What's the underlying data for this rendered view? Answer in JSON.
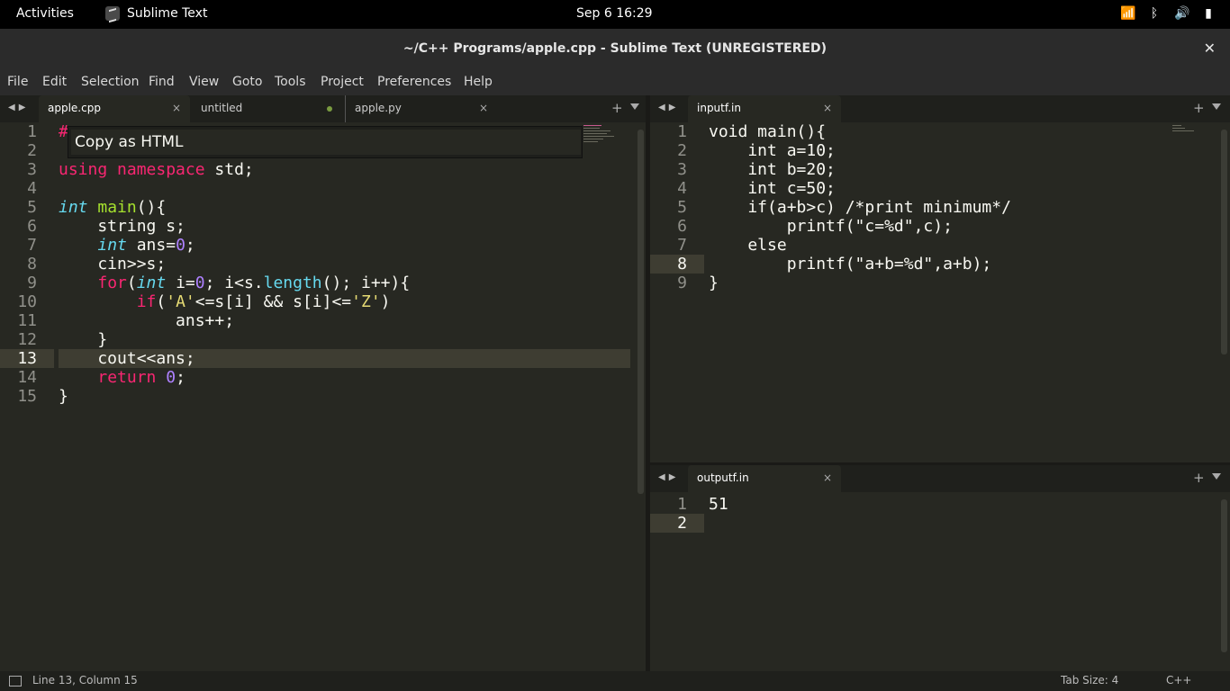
{
  "system_bar": {
    "activities": "Activities",
    "app_name": "Sublime Text",
    "clock": "Sep 6  16:29",
    "tray_icons": [
      "wifi-icon",
      "bluetooth-icon",
      "volume-icon",
      "battery-icon"
    ]
  },
  "window": {
    "title": "~/C++ Programs/apple.cpp - Sublime Text (UNREGISTERED)",
    "close_glyph": "✕"
  },
  "menu": [
    "File",
    "Edit",
    "Selection",
    "Find",
    "View",
    "Goto",
    "Tools",
    "Project",
    "Preferences",
    "Help"
  ],
  "left_group": {
    "tabs": [
      {
        "label": "apple.cpp",
        "active": true,
        "close": "×"
      },
      {
        "label": "untitled",
        "active": false,
        "modified": true
      },
      {
        "label": "apple.py",
        "active": false,
        "close": "×"
      }
    ],
    "line_numbers": [
      "1",
      "2",
      "3",
      "4",
      "5",
      "6",
      "7",
      "8",
      "9",
      "10",
      "11",
      "12",
      "13",
      "14",
      "15"
    ],
    "current_line": 13,
    "first_line_visible": "#"
  },
  "command_input": {
    "value": "Copy as HTML"
  },
  "top_right_group": {
    "tabs": [
      {
        "label": "inputf.in",
        "active": true,
        "close": "×"
      }
    ],
    "line_numbers": [
      "1",
      "2",
      "3",
      "4",
      "5",
      "6",
      "7",
      "8",
      "9"
    ],
    "current_line": 8,
    "lines": [
      "void main(){",
      "    int a=10;",
      "    int b=20;",
      "    int c=50;",
      "    if(a+b>c) /*print minimum*/",
      "        printf(\"c=%d\",c);",
      "    else",
      "        printf(\"a+b=%d\",a+b);",
      "}"
    ]
  },
  "bottom_right_group": {
    "tabs": [
      {
        "label": "outputf.in",
        "active": true,
        "close": "×"
      }
    ],
    "line_numbers": [
      "1",
      "2"
    ],
    "current_line": 2,
    "lines": [
      "51",
      ""
    ]
  },
  "status_bar": {
    "position": "Line 13, Column 15",
    "tab_size": "Tab Size: 4",
    "syntax": "C++"
  },
  "colors": {
    "editor_bg": "#272822",
    "keyword": "#f92672",
    "type": "#66d9ef",
    "function": "#a6e22e",
    "number": "#ae81ff",
    "string": "#e6db74"
  }
}
